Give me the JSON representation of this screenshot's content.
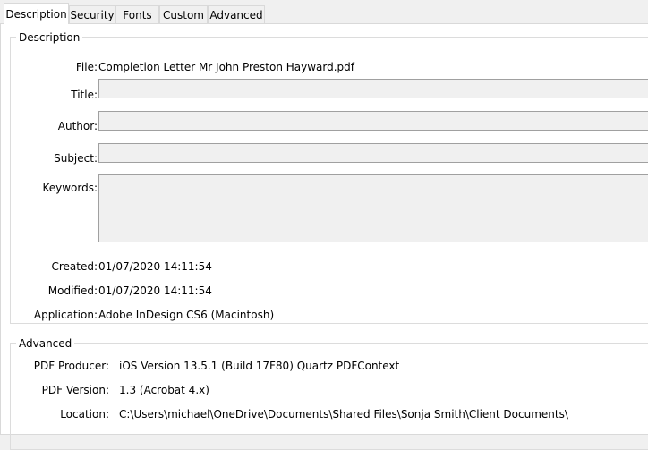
{
  "tabs": [
    {
      "label": "Description"
    },
    {
      "label": "Security"
    },
    {
      "label": "Fonts"
    },
    {
      "label": "Custom"
    },
    {
      "label": "Advanced"
    }
  ],
  "description": {
    "group_title": "Description",
    "file": {
      "label": "File:",
      "value": "Completion Letter Mr John Preston Hayward.pdf"
    },
    "title": {
      "label": "Title:",
      "value": ""
    },
    "author": {
      "label": "Author:",
      "value": ""
    },
    "subject": {
      "label": "Subject:",
      "value": ""
    },
    "keywords": {
      "label": "Keywords:",
      "value": ""
    },
    "created": {
      "label": "Created:",
      "value": "01/07/2020 14:11:54"
    },
    "modified": {
      "label": "Modified:",
      "value": "01/07/2020 14:11:54"
    },
    "application": {
      "label": "Application:",
      "value": "Adobe InDesign CS6 (Macintosh)"
    }
  },
  "advanced": {
    "group_title": "Advanced",
    "pdf_producer": {
      "label": "PDF Producer:",
      "value": "iOS Version 13.5.1 (Build 17F80) Quartz PDFContext"
    },
    "pdf_version": {
      "label": "PDF Version:",
      "value": "1.3 (Acrobat 4.x)"
    },
    "location": {
      "label": "Location:",
      "value": "C:\\Users\\michael\\OneDrive\\Documents\\Shared Files\\Sonja Smith\\Client Documents\\"
    }
  }
}
